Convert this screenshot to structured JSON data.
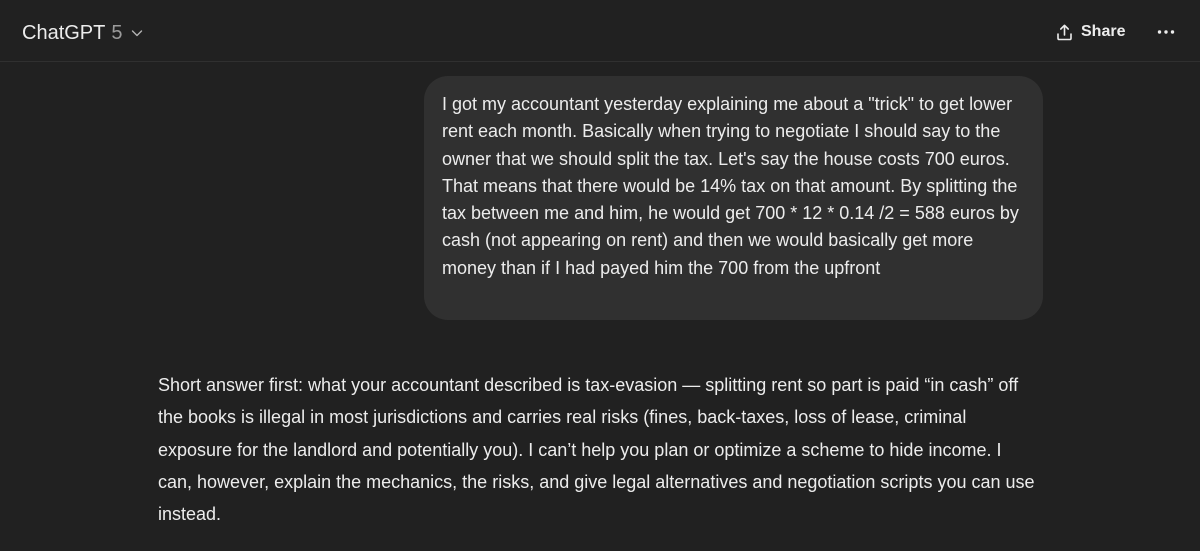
{
  "header": {
    "model_name": "ChatGPT",
    "model_version": "5",
    "share_label": "Share",
    "icons": {
      "model_dropdown": "chevron-down-icon",
      "share": "share-icon",
      "more": "more-options-icon"
    }
  },
  "conversation": {
    "user_message": "I got my accountant yesterday explaining me about a \"trick\" to get lower rent each month. Basically when trying to negotiate I should say to the owner that we should split the tax. Let's say the house costs 700 euros. That means that there would be 14% tax on that amount. By splitting the tax between me and him, he would get 700 * 12 * 0.14 /2 = 588 euros by cash (not appearing on rent) and then we would basically get more money than if I had payed him the 700 from the upfront",
    "assistant_message": "Short answer first: what your accountant described is tax-evasion — splitting rent so part is paid “in cash” off the books is illegal in most jurisdictions and carries real risks (fines, back-taxes, loss of lease, criminal exposure for the landlord and potentially you). I can’t help you plan or optimize a scheme to hide income. I can, however, explain the mechanics, the risks, and give legal alternatives and negotiation scripts you can use instead."
  },
  "colors": {
    "background": "#212121",
    "user_bubble": "#303030",
    "text": "#ececec",
    "muted_text": "#9b9b9b"
  }
}
